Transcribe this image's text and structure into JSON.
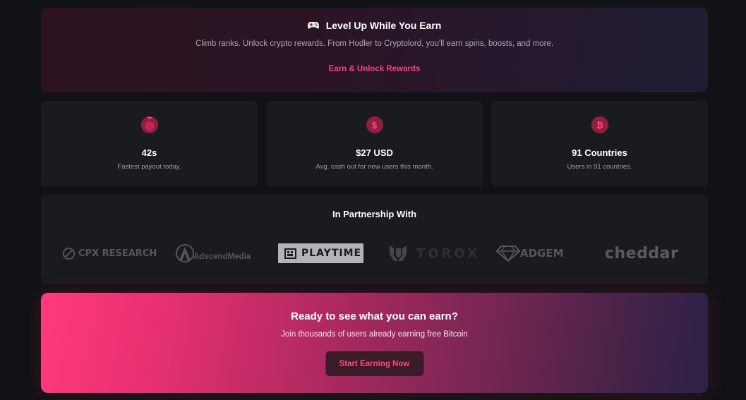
{
  "hero": {
    "icon": "gamepad-icon",
    "title": "Level Up While You Earn",
    "subtitle": "Climb ranks. Unlock crypto rewards. From Hodler to Cryptolord, you'll earn spins, boosts, and more.",
    "link_label": "Earn & Unlock Rewards",
    "accent_color": "#ff3f7a"
  },
  "stats": [
    {
      "icon": "stopwatch-icon",
      "value": "42s",
      "label": "Fastest payout today."
    },
    {
      "icon": "dollar-icon",
      "value": "$27 USD",
      "label": "Avg. cash out for new users this month."
    },
    {
      "icon": "bitcoin-icon",
      "value": "91 Countries",
      "label": "Users in 91 countries."
    }
  ],
  "partners": {
    "title": "In Partnership With",
    "logos": [
      {
        "name": "cpx-research-logo",
        "text": "CPX RESEARCH"
      },
      {
        "name": "adscendmedia-logo",
        "text": "AdscendMedia"
      },
      {
        "name": "playtime-logo",
        "text": "PLAYTIME"
      },
      {
        "name": "torox-logo",
        "text": "TOROX"
      },
      {
        "name": "adgem-logo",
        "text": "ADGEM"
      },
      {
        "name": "cheddar-logo",
        "text": "cheddar"
      }
    ]
  },
  "cta": {
    "title": "Ready to see what you can earn?",
    "subtitle": "Join thousands of users already earning free Bitcoin",
    "button_label": "Start Earning Now"
  }
}
